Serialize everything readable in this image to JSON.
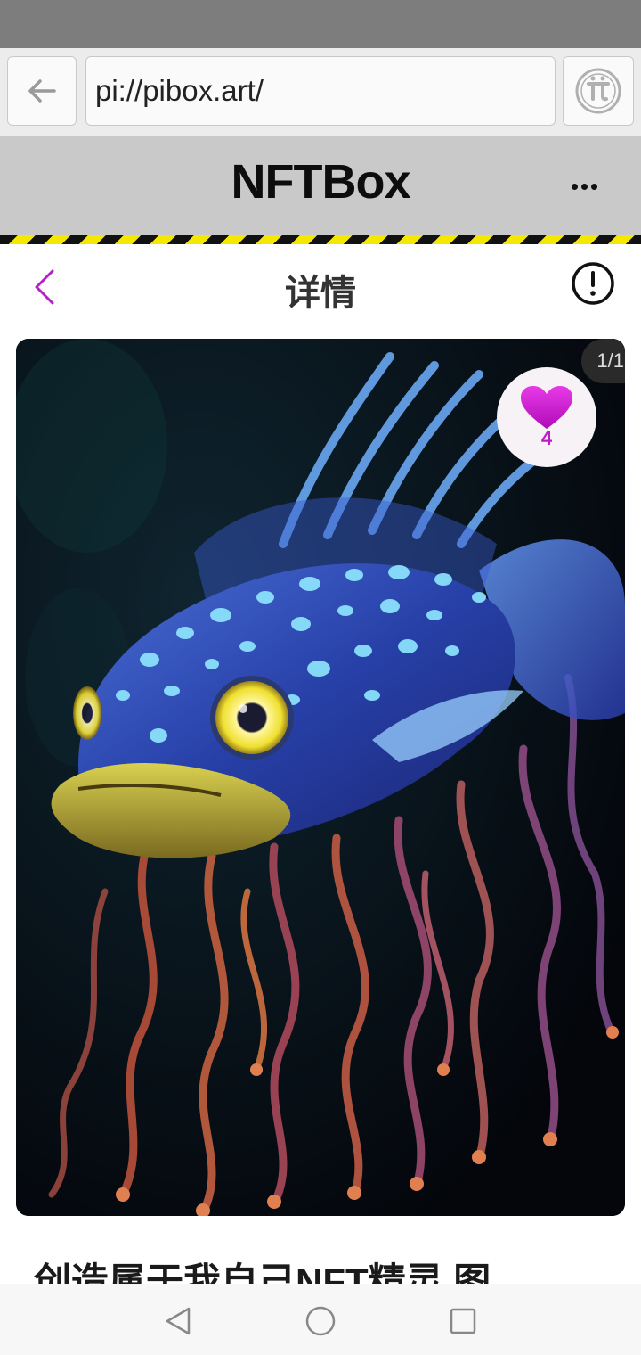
{
  "browser": {
    "url": "pi://pibox.art/",
    "back_icon": "arrow-left-icon",
    "pi_icon": "pi-logo-icon"
  },
  "app": {
    "title": "NFTBox",
    "more_icon": "more-dots-icon"
  },
  "detail": {
    "title": "详情",
    "back_icon": "chevron-left-icon",
    "info_icon": "info-circle-icon",
    "accent_color": "#b620c8"
  },
  "artwork": {
    "page_counter": "1/1",
    "like_count": "4",
    "like_icon": "heart-icon",
    "like_color": "#d61ad8"
  },
  "nft": {
    "title": "创造属于我自己NFT精灵 图"
  },
  "system_nav": {
    "back_icon": "triangle-back-icon",
    "home_icon": "circle-home-icon",
    "recents_icon": "square-recents-icon"
  }
}
